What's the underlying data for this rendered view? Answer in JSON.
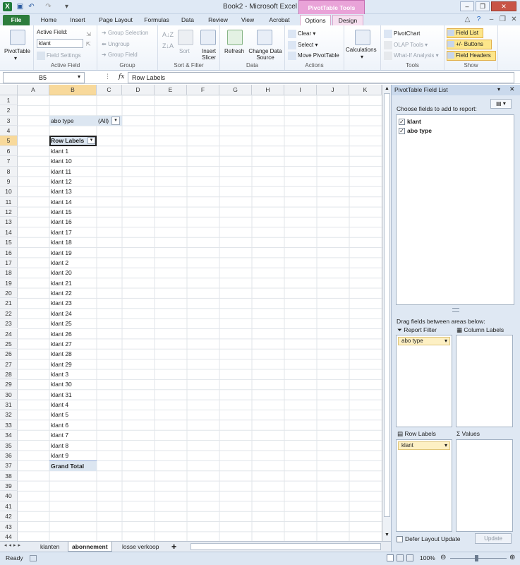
{
  "window": {
    "title": "Book2  -  Microsoft Excel",
    "contextual_tab": "PivotTable Tools"
  },
  "tabs": [
    "File",
    "Home",
    "Insert",
    "Page Layout",
    "Formulas",
    "Data",
    "Review",
    "View",
    "Acrobat",
    "Options",
    "Design"
  ],
  "ribbon": {
    "pivottable_btn": "PivotTable",
    "active_field_label": "Active Field:",
    "active_field_value": "klant",
    "field_settings": "Field Settings",
    "active_field_group": "Active Field",
    "group_selection": "Group Selection",
    "ungroup": "Ungroup",
    "group_field": "Group Field",
    "group_group": "Group",
    "sort": "Sort",
    "insert_slicer": "Insert Slicer",
    "sort_filter_group": "Sort & Filter",
    "refresh": "Refresh",
    "change_data_source": "Change Data Source",
    "data_group": "Data",
    "clear": "Clear",
    "select": "Select",
    "move_pivottable": "Move PivotTable",
    "actions_group": "Actions",
    "calculations": "Calculations",
    "pivotchart": "PivotChart",
    "olap_tools": "OLAP Tools",
    "whatif": "What-If Analysis",
    "tools_group": "Tools",
    "field_list": "Field List",
    "buttons": "+/- Buttons",
    "field_headers": "Field Headers",
    "show_group": "Show"
  },
  "formula": {
    "namebox": "B5",
    "fx": "fx",
    "value": "Row Labels"
  },
  "columns": [
    "A",
    "B",
    "C",
    "D",
    "E",
    "F",
    "G",
    "H",
    "I",
    "J",
    "K"
  ],
  "rows": [
    "1",
    "2",
    "3",
    "4",
    "5",
    "6",
    "7",
    "8",
    "9",
    "10",
    "11",
    "12",
    "13",
    "14",
    "15",
    "16",
    "17",
    "18",
    "19",
    "20",
    "21",
    "22",
    "23",
    "24",
    "25",
    "26",
    "27",
    "28",
    "29",
    "30",
    "31",
    "32",
    "33",
    "34",
    "35",
    "36",
    "37",
    "38",
    "39",
    "40",
    "41",
    "42",
    "43",
    "44"
  ],
  "pivot": {
    "filter_label": "abo type",
    "filter_value": "(All)",
    "row_labels": "Row Labels",
    "items": [
      "klant 1",
      "klant 10",
      "klant 11",
      "klant 12",
      "klant 13",
      "klant 14",
      "klant 15",
      "klant 16",
      "klant 17",
      "klant 18",
      "klant 19",
      "klant 2",
      "klant 20",
      "klant 21",
      "klant 22",
      "klant 23",
      "klant 24",
      "klant 25",
      "klant 26",
      "klant 27",
      "klant 28",
      "klant 29",
      "klant 3",
      "klant 30",
      "klant 31",
      "klant 4",
      "klant 5",
      "klant 6",
      "klant 7",
      "klant 8",
      "klant 9"
    ],
    "grand_total": "Grand Total"
  },
  "sheets": [
    "klanten",
    "abonnement",
    "losse verkoop"
  ],
  "status": {
    "ready": "Ready",
    "zoom": "100%"
  },
  "fieldlist": {
    "title": "PivotTable Field List",
    "choose": "Choose fields to add to report:",
    "fields": [
      "klant",
      "abo type"
    ],
    "drag": "Drag fields between areas below:",
    "report_filter": "Report Filter",
    "column_labels": "Column Labels",
    "row_labels": "Row Labels",
    "values": "Values",
    "filter_item": "abo type",
    "row_item": "klant",
    "defer": "Defer Layout Update",
    "update": "Update"
  }
}
